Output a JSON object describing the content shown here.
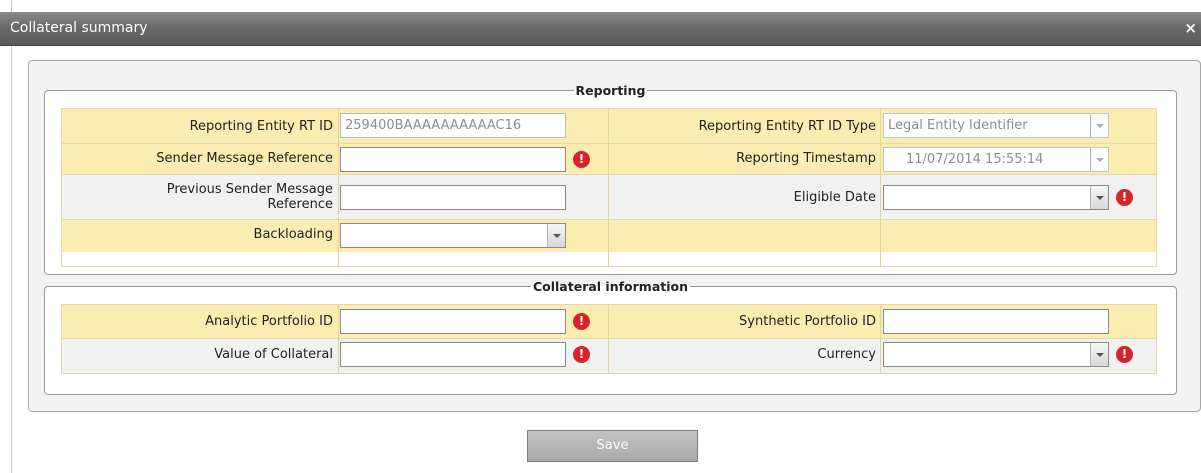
{
  "dialog": {
    "title": "Collateral summary",
    "close_glyph": "×"
  },
  "reporting": {
    "legend": "Reporting",
    "reporting_entity_rt_id": {
      "label": "Reporting Entity RT ID",
      "value": "259400BAAAAAAAAAAC16"
    },
    "reporting_entity_rt_id_type": {
      "label": "Reporting Entity RT ID Type",
      "value": "Legal Entity Identifier"
    },
    "sender_message_reference": {
      "label": "Sender Message Reference",
      "value": ""
    },
    "reporting_timestamp": {
      "label": "Reporting Timestamp",
      "value": "11/07/2014 15:55:14"
    },
    "previous_sender_message_reference": {
      "label_line1": "Previous Sender Message",
      "label_line2": "Reference",
      "value": ""
    },
    "eligible_date": {
      "label": "Eligible Date",
      "value": ""
    },
    "backloading": {
      "label": "Backloading",
      "value": ""
    }
  },
  "collateral": {
    "legend": "Collateral information",
    "analytic_portfolio_id": {
      "label": "Analytic Portfolio ID",
      "value": ""
    },
    "synthetic_portfolio_id": {
      "label": "Synthetic Portfolio ID",
      "value": ""
    },
    "value_of_collateral": {
      "label": "Value of Collateral",
      "value": ""
    },
    "currency": {
      "label": "Currency",
      "value": ""
    }
  },
  "required_glyph": "!",
  "footer": {
    "save_label": "Save"
  },
  "colors": {
    "titlebar": "#6a6a6a",
    "row_gold": "#fbecb2",
    "row_gray": "#f1f1f1",
    "required_red": "#d8232a",
    "save_button": "#b4b4b4"
  }
}
